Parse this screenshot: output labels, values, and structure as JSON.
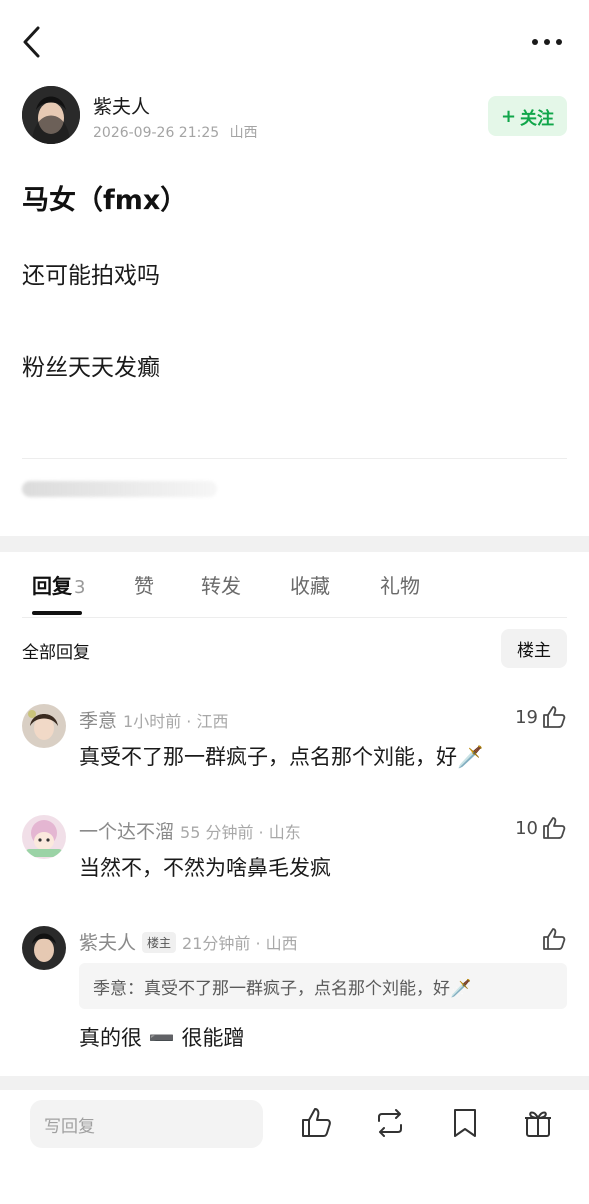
{
  "author": {
    "name": "紫夫人",
    "datetime": "2026-09-26 21:25",
    "location": "山西",
    "follow_label": "关注",
    "follow_plus": "+"
  },
  "post": {
    "title": "马女（fmx）",
    "lines": [
      "还可能拍戏吗",
      "粉丝天天发癫"
    ]
  },
  "tabs": [
    {
      "label": "回复",
      "count": "3",
      "active": true
    },
    {
      "label": "赞"
    },
    {
      "label": "转发"
    },
    {
      "label": "收藏"
    },
    {
      "label": "礼物"
    }
  ],
  "filter": {
    "all_label": "全部回复",
    "op_label": "楼主"
  },
  "comments": [
    {
      "name": "季意",
      "meta": "1小时前 · 江西",
      "text": "真受不了那一群疯子，点名那个刘能，好🗡️",
      "likes": "19"
    },
    {
      "name": "一个达不溜",
      "meta": "55 分钟前 · 山东",
      "text": "当然不，不然为啥鼻毛发疯",
      "likes": "10"
    },
    {
      "name": "紫夫人",
      "badge": "楼主",
      "meta": "21分钟前 · 山西",
      "quote": "季意：真受不了那一群疯子，点名那个刘能，好🗡️",
      "text": "真的很 ➖ 很能蹭",
      "likes": ""
    }
  ],
  "bottom_bar": {
    "reply_placeholder": "写回复",
    "icons": [
      "thumbs-up-icon",
      "repost-icon",
      "bookmark-icon",
      "gift-icon"
    ]
  },
  "colors": {
    "accent_green": "#10a64a",
    "follow_bg": "#e4f7e8"
  }
}
